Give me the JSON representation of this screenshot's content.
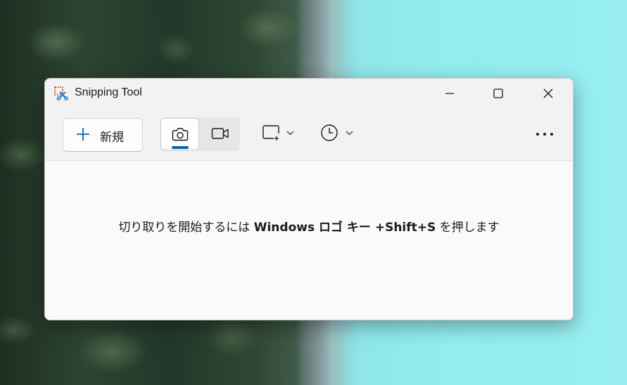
{
  "window": {
    "title": "Snipping Tool"
  },
  "toolbar": {
    "new_label": "新規",
    "modes": [
      {
        "name": "camera-icon",
        "selected": true
      },
      {
        "name": "video-camera-icon",
        "selected": false
      }
    ],
    "snip_shape_icon": "rectangle-snip-icon",
    "timer_icon": "clock-icon",
    "more_icon": "more-horizontal-icon"
  },
  "content": {
    "hint_prefix": "切り取りを開始するには ",
    "hint_bold": "Windows ロゴ キー +Shift+S",
    "hint_suffix": " を押します"
  },
  "colors": {
    "accent": "#0067c0",
    "titlebar": "#f2f2f2",
    "content_bg": "#fafafa"
  }
}
